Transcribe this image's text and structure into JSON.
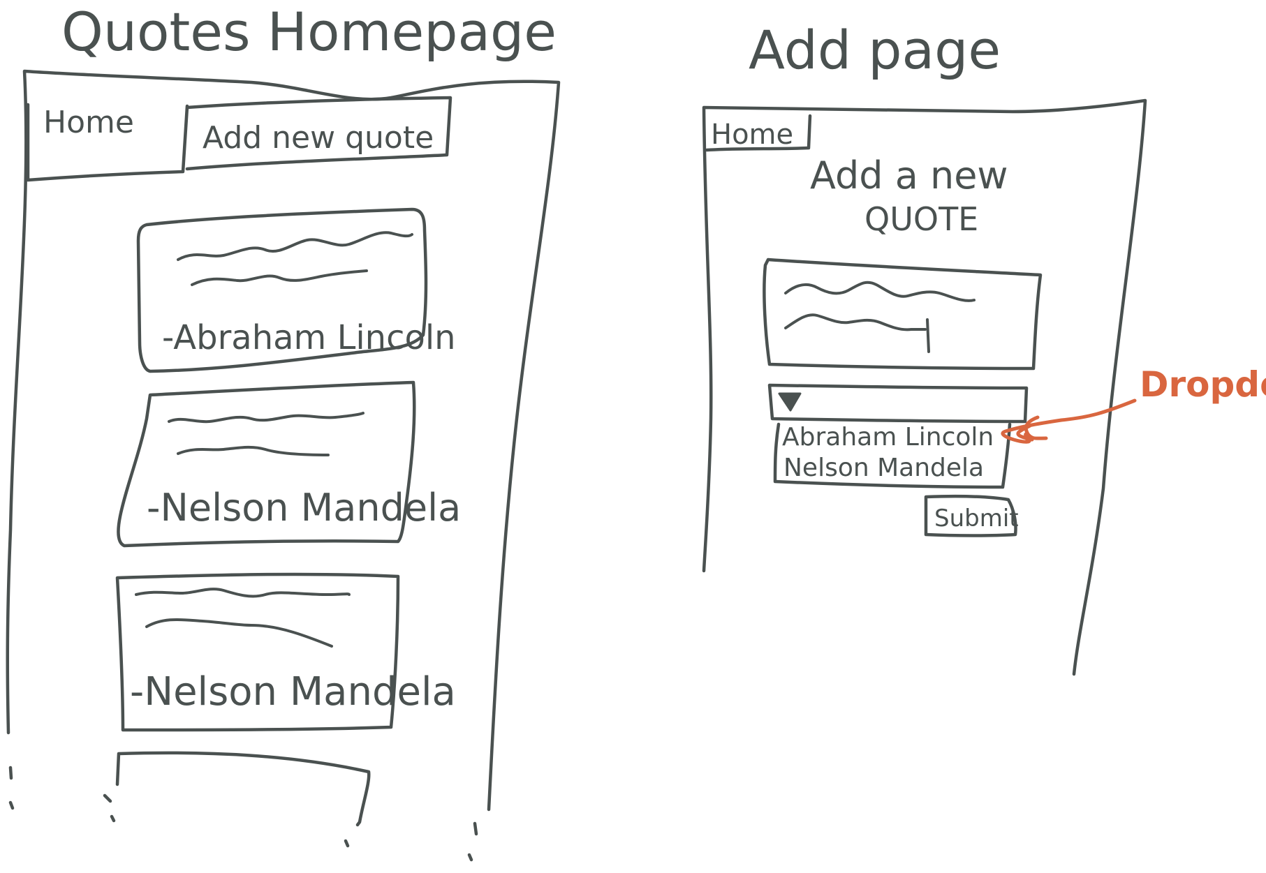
{
  "colors": {
    "ink": "#4a5150",
    "accent": "#d9663f"
  },
  "home_page": {
    "title": "Quotes Homepage",
    "nav": {
      "home_tab": "Home",
      "add_tab": "Add new quote"
    },
    "quote_cards": [
      {
        "author": "-Abraham Lincoln"
      },
      {
        "author": "-Nelson Mandela"
      },
      {
        "author": "-Nelson Mandela"
      }
    ]
  },
  "add_page": {
    "title": "Add page",
    "nav": {
      "home_tab": "Home"
    },
    "heading_line1": "Add a new",
    "heading_line2": "QUOTE",
    "dropdown_options": [
      "Abraham Lincoln",
      "Nelson Mandela"
    ],
    "submit_label": "Submit",
    "annotation": "Dropdown",
    "dropdown_icon": "triangle-down-icon"
  }
}
